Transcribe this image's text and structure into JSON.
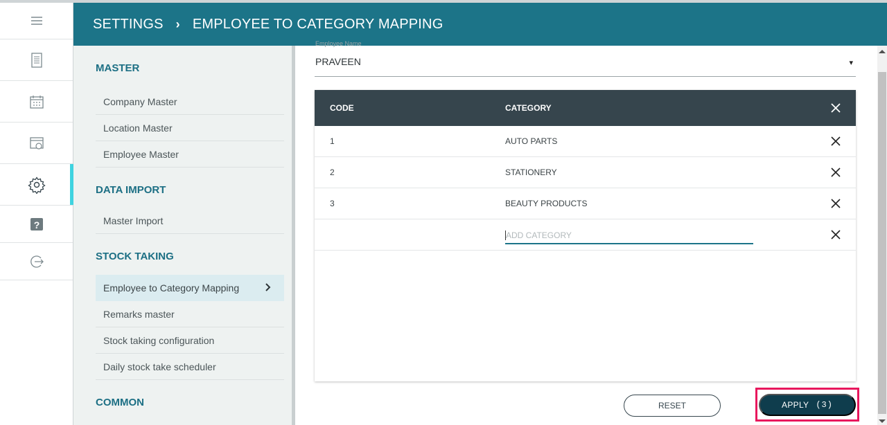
{
  "header": {
    "section": "SETTINGS",
    "separator": "›",
    "page": "EMPLOYEE TO CATEGORY MAPPING"
  },
  "rail": {
    "items": [
      {
        "icon": "hamburger-menu-icon"
      },
      {
        "icon": "report-icon"
      },
      {
        "icon": "calendar-icon"
      },
      {
        "icon": "history-icon"
      },
      {
        "icon": "gear-icon",
        "active": true
      },
      {
        "icon": "help-icon"
      },
      {
        "icon": "logout-icon"
      }
    ]
  },
  "subnav": {
    "sections": [
      {
        "title": "MASTER",
        "items": [
          "Company Master",
          "Location Master",
          "Employee Master"
        ]
      },
      {
        "title": "DATA IMPORT",
        "items": [
          "Master Import"
        ]
      },
      {
        "title": "STOCK TAKING",
        "items": [
          "Employee to Category Mapping",
          "Remarks master",
          "Stock taking configuration",
          "Daily stock take scheduler"
        ],
        "active_item": "Employee to Category Mapping"
      },
      {
        "title": "COMMON",
        "items": []
      }
    ]
  },
  "employee": {
    "label": "Employee Name",
    "value": "PRAVEEN",
    "caret": "▾"
  },
  "table": {
    "columns": [
      "CODE",
      "CATEGORY"
    ],
    "rows": [
      {
        "code": "1",
        "category": "AUTO PARTS"
      },
      {
        "code": "2",
        "category": "STATIONERY"
      },
      {
        "code": "3",
        "category": "BEAUTY PRODUCTS"
      }
    ],
    "add_placeholder": "ADD CATEGORY",
    "add_value": ""
  },
  "actions": {
    "reset_label": "RESET",
    "apply_label": "APPLY",
    "apply_count": "(3)"
  },
  "colors": {
    "header_bg": "#1c7488",
    "table_header_bg": "#36454d",
    "apply_bg": "#0f3d4d",
    "highlight": "#e8175d",
    "active_rail": "#3fd3e0"
  }
}
